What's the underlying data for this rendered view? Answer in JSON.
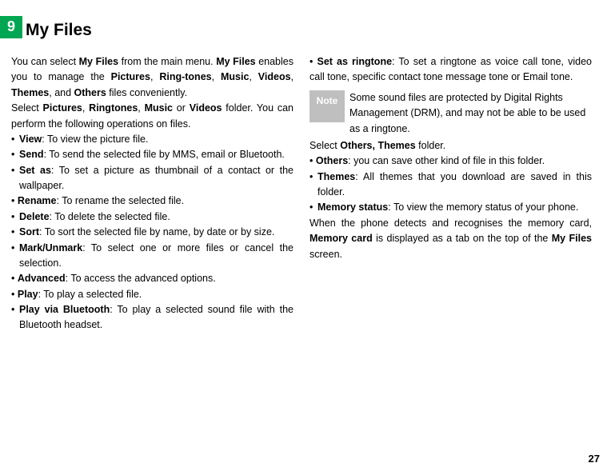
{
  "section_number": "9",
  "title": "My Files",
  "left": {
    "intro1": "You can select ",
    "intro1b": "My Files",
    "intro1c": " from the main menu. ",
    "intro1d": "My Files",
    "intro1e": " enables you to manage the ",
    "intro1_pictures": "Pictures",
    "intro1_ringtones": "Ring-tones",
    "intro1_music": "Music",
    "intro1_videos": "Videos",
    "intro1_themes": "Themes",
    "intro1_and": ", and ",
    "intro1_others": "Others",
    "intro1_tail": " files conveniently.",
    "intro2a": "Select  ",
    "intro2_pictures": "Pictures",
    "intro2_ringtones": "Ringtones",
    "intro2_music": "Music",
    "intro2_or": " or ",
    "intro2_videos": "Videos",
    "intro2_tail": " folder. You can perform the following operations on files.",
    "items": [
      {
        "label": "View",
        "text": ": To view the picture file."
      },
      {
        "label": "Send",
        "text": ": To send the selected file by MMS, email or Bluetooth."
      },
      {
        "label": "Set as",
        "text": ": To set a picture as thumbnail of a contact or the wallpaper."
      },
      {
        "label": "Rename",
        "text": ": To rename the selected file."
      },
      {
        "label": "Delete",
        "text": ": To delete the selected file."
      },
      {
        "label": "Sort",
        "text": ": To sort the selected file by name, by date or by size."
      },
      {
        "label": "Mark/Unmark",
        "text": ": To select one or more files or cancel the selection."
      },
      {
        "label": "Advanced",
        "text": ": To access the advanced options."
      },
      {
        "label": "Play",
        "text": ": To play a selected file."
      },
      {
        "label": "Play via Bluetooth",
        "text": ": To play a selected sound file with the Bluetooth headset."
      }
    ]
  },
  "right": {
    "setringtone_label": "Set as ringtone",
    "setringtone_text": ": To set a ringtone as voice call tone, video call tone, specific contact tone message tone or Email tone.",
    "note_label": "Note",
    "note_text": "Some sound files are protected by Digital Rights Management (DRM), and may not be able to be used as a ringtone.",
    "select1a": "Select ",
    "select1b": "Others, Themes",
    "select1c": " folder.",
    "items": [
      {
        "label": "Others",
        "text": ": you can save other kind of file in this folder."
      },
      {
        "label": "Themes",
        "text": ": All themes that you download are saved in this folder."
      },
      {
        "label": "Memory status",
        "text": ": To view the memory status of your phone."
      }
    ],
    "footer1": "When the phone detects and recognises the memory card, ",
    "footer1b": "Memory card",
    "footer1c": " is displayed as a tab on the top of the ",
    "footer1d": "My Files",
    "footer1e": " screen."
  },
  "page_number": "27"
}
